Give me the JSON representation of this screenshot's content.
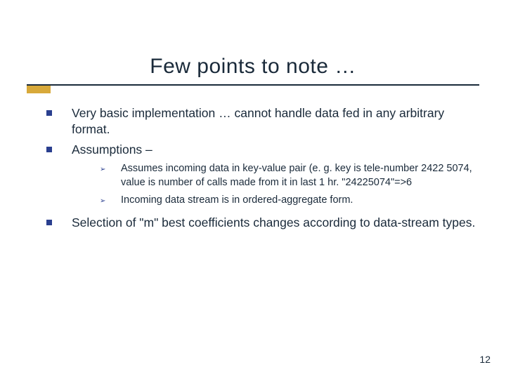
{
  "title": "Few points to note …",
  "bullets": {
    "b1": "Very basic implementation … cannot handle data fed in any arbitrary format.",
    "b2": "Assumptions –",
    "b3": "Selection of \"m\" best coefficients changes according to data-stream types."
  },
  "sub": {
    "s1": "Assumes incoming data in key-value pair (e. g. key is tele-number 2422 5074, value is number of calls made from it in last 1 hr. \"24225074\"=>6",
    "s2": "Incoming data stream is in ordered-aggregate form."
  },
  "page_number": "12"
}
